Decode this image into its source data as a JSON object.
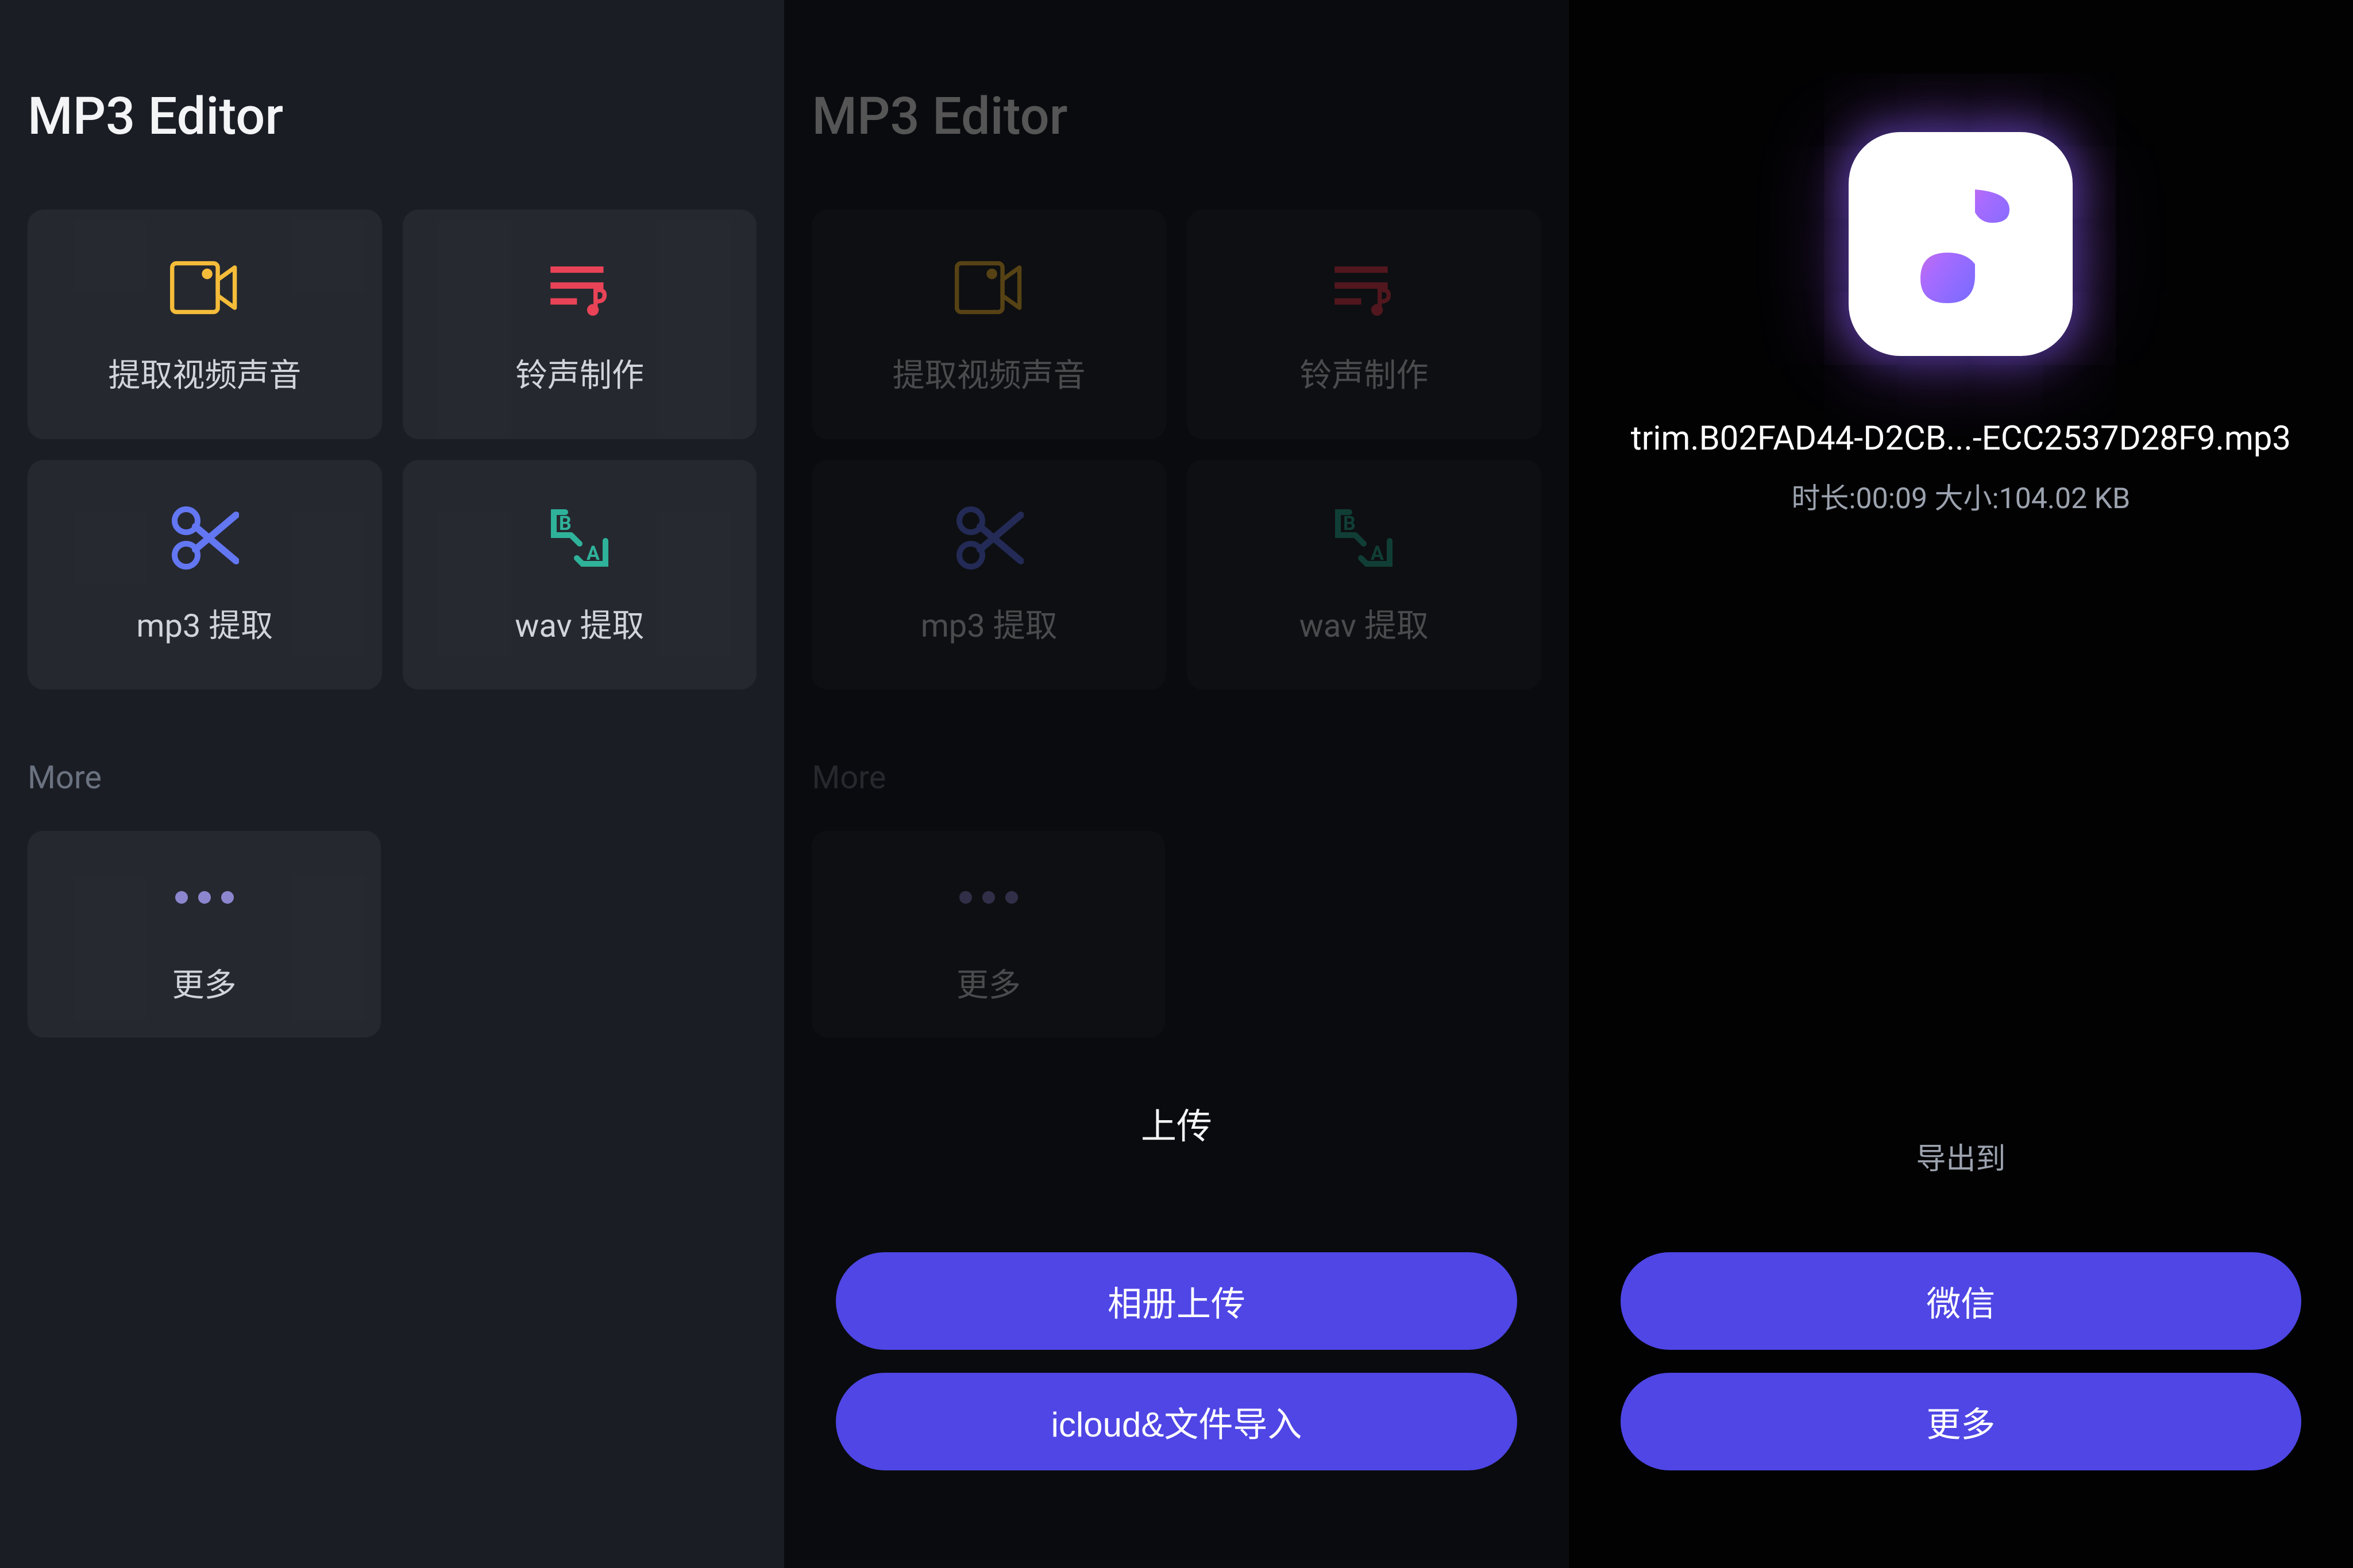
{
  "pane1": {
    "app_title": "MP3 Editor",
    "tools": [
      {
        "id": "extract-video-audio",
        "label": "提取视频声音",
        "icon": "video-camera-icon"
      },
      {
        "id": "ringtone-maker",
        "label": "铃声制作",
        "icon": "ringtone-list-icon"
      },
      {
        "id": "mp3-extract",
        "label": "mp3 提取",
        "icon": "scissors-icon"
      },
      {
        "id": "wav-extract",
        "label": "wav 提取",
        "icon": "translate-icon"
      }
    ],
    "section_more": "More",
    "more_card_label": "更多"
  },
  "pane2": {
    "app_title": "MP3 Editor",
    "section_more": "More",
    "more_card_label": "更多",
    "sheet_title": "上传",
    "actions": [
      {
        "id": "upload-album",
        "label": "相册上传"
      },
      {
        "id": "icloud-import",
        "label": "icloud&文件导入"
      }
    ]
  },
  "pane3": {
    "filename": "trim.B02FAD44-D2CB...-ECC2537D28F9.mp3",
    "fileinfo": "时长:00:09 大小:104.02 KB",
    "export_label": "导出到",
    "actions": [
      {
        "id": "export-wechat",
        "label": "微信"
      },
      {
        "id": "export-more",
        "label": "更多"
      }
    ]
  },
  "colors": {
    "accent_yellow": "#f5bc3a",
    "accent_red": "#e94357",
    "accent_blue": "#6377f3",
    "accent_teal": "#2fb29a",
    "accent_purple": "#8c86cf",
    "primary_button": "#4f46e5"
  }
}
